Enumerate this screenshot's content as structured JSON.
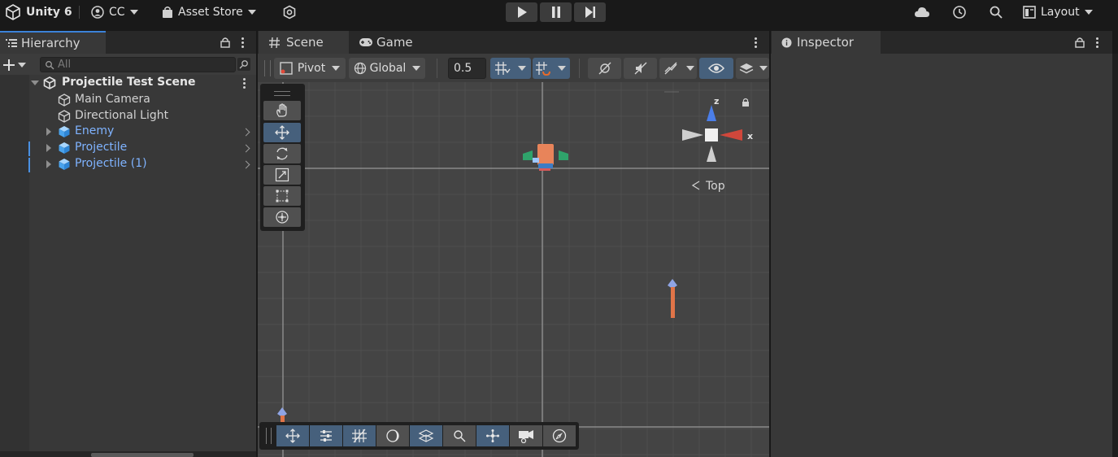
{
  "topbar": {
    "app_title": "Unity 6",
    "account_label": "CC",
    "asset_store_label": "Asset Store",
    "layout_label": "Layout"
  },
  "hierarchy": {
    "tab_label": "Hierarchy",
    "search_placeholder": "All",
    "scene_name": "Projectile Test Scene",
    "items": [
      {
        "label": "Main Camera",
        "type": "object"
      },
      {
        "label": "Directional Light",
        "type": "object"
      },
      {
        "label": "Enemy",
        "type": "prefab"
      },
      {
        "label": "Projectile",
        "type": "prefab"
      },
      {
        "label": "Projectile (1)",
        "type": "prefab"
      }
    ]
  },
  "scene": {
    "tab_scene": "Scene",
    "tab_game": "Game",
    "pivot_label": "Pivot",
    "global_label": "Global",
    "snap_value": "0.5",
    "gizmo_view_label": "Top",
    "gizmo_axis_z": "z",
    "gizmo_axis_x": "x"
  },
  "inspector": {
    "tab_label": "Inspector"
  },
  "colors": {
    "accent_blue": "#46607c",
    "prefab_blue": "#7fb3ff",
    "grid_bg": "#444444"
  }
}
